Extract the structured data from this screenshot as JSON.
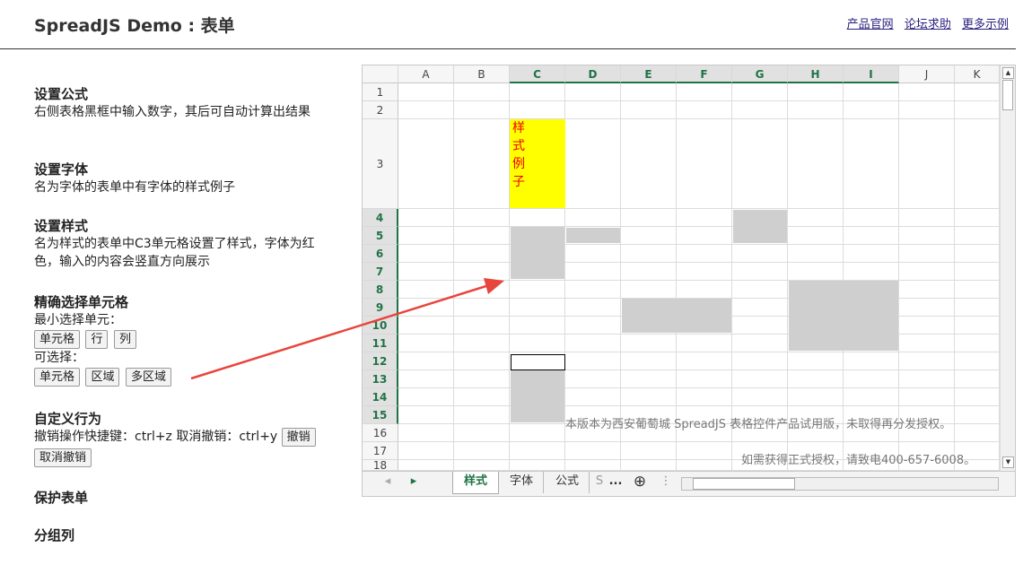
{
  "header": {
    "title": "SpreadJS Demo : 表单",
    "links": [
      "产品官网",
      "论坛求助",
      "更多示例"
    ]
  },
  "sections": {
    "formula": {
      "title": "设置公式",
      "desc": "右侧表格黑框中输入数字，其后可自动计算出结果"
    },
    "font": {
      "title": "设置字体",
      "desc": "名为字体的表单中有字体的样式例子"
    },
    "style": {
      "title": "设置样式",
      "desc": "名为样式的表单中C3单元格设置了样式，字体为红色，输入的内容会竖直方向展示"
    },
    "select": {
      "title": "精确选择单元格",
      "min_label": "最小选择单元：",
      "min_buttons": [
        "单元格",
        "行",
        "列"
      ],
      "opt_label": "可选择：",
      "opt_buttons": [
        "单元格",
        "区域",
        "多区域"
      ]
    },
    "behavior": {
      "title": "自定义行为",
      "desc": "撤销操作快捷键：ctrl+z 取消撤销：ctrl+y",
      "undo": "撤销",
      "redo": "取消撤销"
    },
    "protect": {
      "title": "保护表单"
    },
    "group": {
      "title": "分组列"
    }
  },
  "sheet": {
    "columns": [
      "A",
      "B",
      "C",
      "D",
      "E",
      "F",
      "G",
      "H",
      "I",
      "J",
      "K"
    ],
    "rows": [
      "1",
      "2",
      "3",
      "4",
      "5",
      "6",
      "7",
      "8",
      "9",
      "10",
      "11",
      "12",
      "13",
      "14",
      "15",
      "16",
      "17",
      "18"
    ],
    "selected_columns": [
      "C",
      "D",
      "E",
      "F",
      "G",
      "H",
      "I"
    ],
    "selected_rows": [
      "4",
      "5",
      "6",
      "7",
      "8",
      "9",
      "10",
      "11",
      "12",
      "13",
      "14",
      "15"
    ],
    "styled_cell_chars": [
      "样",
      "式",
      "例",
      "子"
    ],
    "watermark_line1": "本版本为西安葡萄城 SpreadJS 表格控件产品试用版，未取得再分发授权。",
    "watermark_line2": "如需获得正式授权，请致电400-657-6008。",
    "tabs": [
      "样式",
      "字体",
      "公式",
      "S"
    ],
    "active_tab": "样式",
    "tab_more": "...",
    "tab_add": "⊕",
    "tab_menu": "⋮",
    "nav_prev": "◂",
    "nav_next": "▸"
  },
  "colors": {
    "link": "#2a1e7e",
    "sheet_accent": "#217346",
    "styled_bg": "#ffff00",
    "styled_text": "#ee0000",
    "arrow": "#e8453c"
  }
}
